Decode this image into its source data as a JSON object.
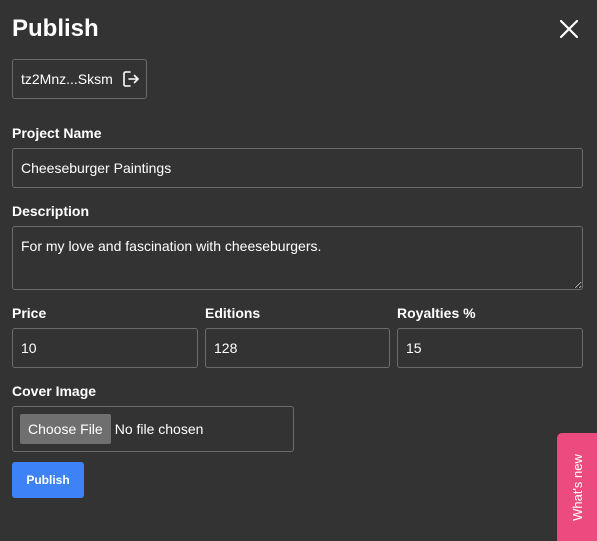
{
  "dialog": {
    "title": "Publish",
    "close_icon": "close-icon"
  },
  "wallet": {
    "address": "tz2Mnz...Sksm",
    "icon": "logout-icon"
  },
  "form": {
    "project_name": {
      "label": "Project Name",
      "value": "Cheeseburger Paintings"
    },
    "description": {
      "label": "Description",
      "value": "For my love and fascination with cheeseburgers."
    },
    "price": {
      "label": "Price",
      "value": "10"
    },
    "editions": {
      "label": "Editions",
      "value": "128"
    },
    "royalties": {
      "label": "Royalties %",
      "value": "15"
    },
    "cover_image": {
      "label": "Cover Image",
      "button_label": "Choose File",
      "status": "No file chosen"
    },
    "submit_label": "Publish"
  },
  "whats_new": {
    "label": "What's new"
  },
  "colors": {
    "background": "#333333",
    "border": "#6b6b6b",
    "primary": "#3d82f6",
    "whats_new": "#ec4b80"
  }
}
